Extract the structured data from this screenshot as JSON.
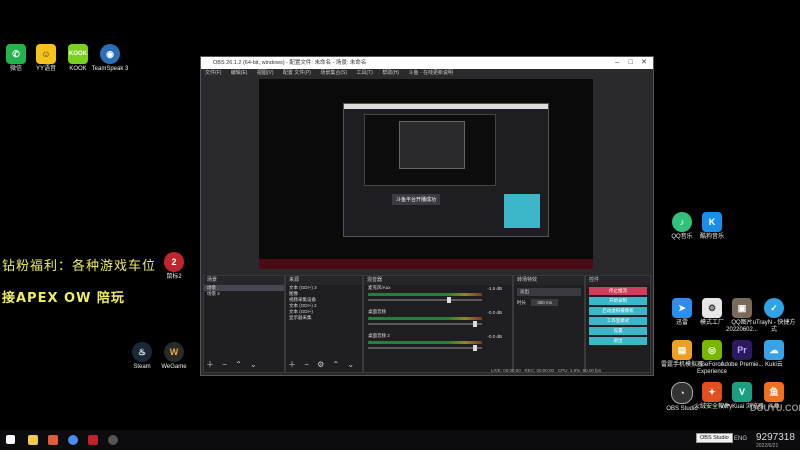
{
  "desktop_icons": [
    {
      "label": "微信",
      "icon": "wechat-icon",
      "color": "#23b24b"
    },
    {
      "label": "YY语音",
      "icon": "yy-icon",
      "color": "#f4c21b"
    },
    {
      "label": "KOOK",
      "icon": "kook-icon",
      "color": "#7cd11f",
      "glyph": "KOOK"
    },
    {
      "label": "TeamSpeak 3",
      "icon": "teamspeak-icon",
      "color": "#2d6fb6"
    }
  ],
  "left_bottom_icons": [
    {
      "label": "Steam",
      "icon": "steam-icon",
      "color": "#1b2838"
    },
    {
      "label": "WeGame",
      "icon": "wegame-icon",
      "color": "#e0b03a"
    }
  ],
  "overlay": {
    "line1": "钻粉福利：各种游戏车位",
    "line2": "接APEX OW 陪玩",
    "icon_label": "鼠标2"
  },
  "right_icons": [
    {
      "label": "QQ音乐",
      "icon": "qqmusic-icon",
      "color": "#31c27c"
    },
    {
      "label": "酷狗音乐",
      "icon": "kugou-icon",
      "color": "#1a8ee8"
    },
    {
      "label": "迅雷",
      "icon": "xunlei-icon",
      "color": "#2d8ef0"
    },
    {
      "label": "模式工厂",
      "icon": "factory-icon",
      "color": "#e6e6e6"
    },
    {
      "label": "QQ图片 20220602...",
      "icon": "photo-icon",
      "color": "#7b6a5a"
    },
    {
      "label": "uTrayN - 快捷方式",
      "icon": "utray-icon",
      "color": "#2fa3e6"
    },
    {
      "label": "雷霆手机模拟器",
      "icon": "emulator-icon",
      "color": "#f0a020"
    },
    {
      "label": "GeForce Experience",
      "icon": "nvidia-icon",
      "color": "#76b900"
    },
    {
      "label": "Adobe Premie...",
      "icon": "premiere-icon",
      "color": "#2a1a5e",
      "glyph": "Pr"
    },
    {
      "label": "Kuki云",
      "icon": "cloud-icon",
      "color": "#3aa0e8"
    },
    {
      "label": "OBS Studio",
      "icon": "obs-icon",
      "color": "#333333"
    },
    {
      "label": "火绒安全软件",
      "icon": "huorong-icon",
      "color": "#e05020"
    },
    {
      "label": "VeryKuai 浏览器",
      "icon": "verykuai-icon",
      "color": "#1aa080"
    },
    {
      "label": "斗鱼",
      "icon": "douyu-icon",
      "color": "#f07020"
    }
  ],
  "obs": {
    "title": "OBS 26.1.2 (64-bit, windows) - 配置文件: 未命名 - 场景: 未命名",
    "menu": [
      "文件(F)",
      "编辑(E)",
      "视图(V)",
      "配置 文件(P)",
      "场景集合(S)",
      "工具(T)",
      "帮助(H)",
      "斗鱼 - 在线更新说明"
    ],
    "scenes_title": "场景",
    "scenes": [
      "场景",
      "场景 2"
    ],
    "sources_title": "来源",
    "sources": [
      "文本 (GDI+) 3",
      "图像",
      "视频采集设备",
      "文本 (GDI+) 2",
      "文本 (GDI+)",
      "显示器采集"
    ],
    "mixer_title": "混音器",
    "mixer": [
      {
        "name": "麦克风/Aux",
        "db": "-1.5 dB",
        "level": 0.72
      },
      {
        "name": "桌面音频",
        "db": "-0.0 dB",
        "level": 0.95
      },
      {
        "name": "桌面音频 2",
        "db": "-0.0 dB",
        "level": 0.95
      }
    ],
    "transitions_title": "转场特效",
    "transition": "淡出",
    "duration_label": "时长",
    "duration": "300 ms",
    "controls_title": "控件",
    "controls": [
      "停止推流",
      "开始录制",
      "启动虚拟摄像机",
      "工作室模式",
      "设置",
      "退出"
    ],
    "status": {
      "live": "LIVE: 00:00:00",
      "rec": "REC: 00:00:00",
      "cpu": "CPU: 1.9%, 60.00 fps"
    },
    "preview_overlay": "斗鱼平台开播成功"
  },
  "taskbar": {
    "tooltip": "OBS Studio",
    "lang": "ENG",
    "time": "9297318",
    "date": "2022/6/21"
  },
  "watermark": "DOUYU.COM"
}
